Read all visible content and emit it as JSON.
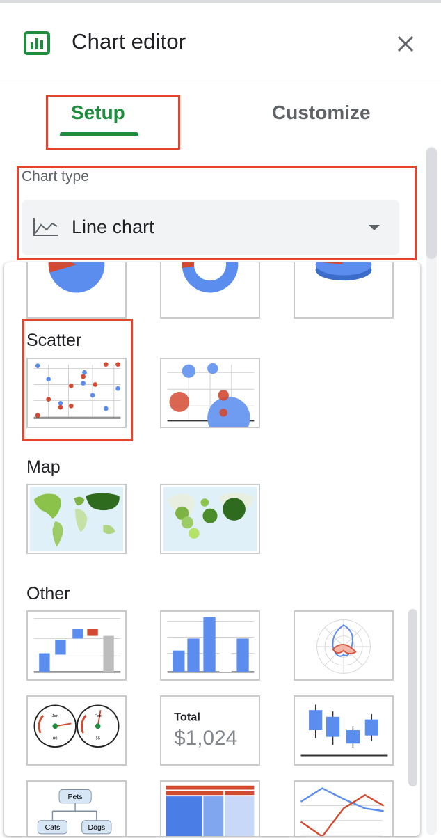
{
  "header": {
    "title": "Chart editor",
    "icon": "chart-icon",
    "close_icon": "close-icon"
  },
  "tabs": [
    {
      "label": "Setup",
      "active": true
    },
    {
      "label": "Customize",
      "active": false
    }
  ],
  "chart_type": {
    "label": "Chart type",
    "selected": "Line chart",
    "icon": "line-chart-icon"
  },
  "colors": {
    "accent_green": "#1e8e3e",
    "highlight_red": "#e2452c",
    "chart_blue": "#5b8def",
    "chart_red": "#d34a32"
  },
  "gallery": {
    "pie_row": [
      "pie-chart",
      "donut-chart",
      "3d-pie-chart"
    ],
    "sections": [
      {
        "label": "Scatter",
        "items": [
          "scatter-chart",
          "bubble-chart"
        ]
      },
      {
        "label": "Map",
        "items": [
          "geo-chart",
          "geo-chart-with-markers"
        ]
      },
      {
        "label": "Other",
        "items": [
          "waterfall-chart",
          "histogram-chart",
          "radar-chart",
          "gauge-chart",
          "scorecard-chart",
          "candlestick-chart",
          "organizational-chart",
          "treemap-chart",
          "timeline-chart"
        ]
      }
    ],
    "gauge": {
      "left_label_top": "Jan",
      "left_label_bottom": "80",
      "right_label_top": "Feb",
      "right_label_bottom": "55"
    },
    "scorecard": {
      "title": "Total",
      "value": "$1,024"
    },
    "org": {
      "root": "Pets",
      "child_left": "Cats",
      "child_right": "Dogs"
    }
  }
}
